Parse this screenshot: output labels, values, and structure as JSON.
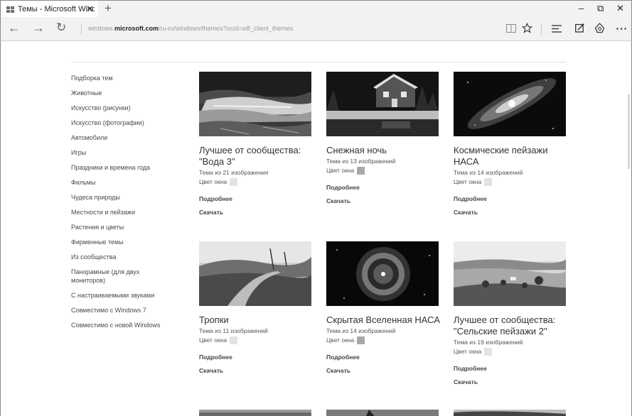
{
  "browser": {
    "tab_title": "Темы - Microsoft Windc",
    "tab_close": "✕",
    "new_tab": "+",
    "window_controls": {
      "minimize": "–",
      "maximize": "⧉",
      "close": "✕"
    },
    "nav": {
      "back": "←",
      "forward": "→",
      "refresh": "↻"
    },
    "url_prefix": "windows.",
    "url_domain": "microsoft.com",
    "url_path": "/ru-ru/windows/themes?ocid=w8_client_themes",
    "toolbar_icons": [
      "reading-view-icon",
      "favorite-star-icon",
      "hub-icon",
      "web-note-icon",
      "share-icon",
      "more-icon"
    ]
  },
  "sidebar": {
    "items": [
      "Подборка тем",
      "Животные",
      "Искусство (рисунки)",
      "Искусство (фотографии)",
      "Автомобили",
      "Игры",
      "Праздники и времена года",
      "Фильмы",
      "Чудеса природы",
      "Местности и пейзажи",
      "Растения и цветы",
      "Фирменные темы",
      "Из сообщества",
      "Панорамные (для двух мониторов)",
      "С настраиваемыми звуками",
      "Совместимо с Windows 7",
      "Совместимо с новой Windows"
    ]
  },
  "themes": [
    {
      "title": "Лучшее от сообщества: \"Вода 3\"",
      "subtitle": "Тема из 21 изображения",
      "color_label": "Цвет окна",
      "swatch": "#e3e3e3",
      "more": "Подробнее",
      "download": "Скачать"
    },
    {
      "title": "Снежная ночь",
      "subtitle": "Тема из 13 изображений",
      "color_label": "Цвет окна",
      "swatch": "#a9a9a9",
      "more": "Подробнее",
      "download": "Скачать"
    },
    {
      "title": "Космические пейзажи НАСА",
      "subtitle": "Тема из 14 изображений",
      "color_label": "Цвет окна",
      "swatch": "#e3e3e3",
      "more": "Подробнее",
      "download": "Скачать"
    },
    {
      "title": "Тропки",
      "subtitle": "Тема из 11 изображений",
      "color_label": "Цвет окна",
      "swatch": "#e3e3e3",
      "more": "Подробнее",
      "download": "Скачать"
    },
    {
      "title": "Скрытая Вселенная НАСА",
      "subtitle": "Тема из 14 изображений",
      "color_label": "Цвет окна",
      "swatch": "#a9a9a9",
      "more": "Подробнее",
      "download": "Скачать"
    },
    {
      "title": "Лучшее от сообщества: \"Сельские пейзажи 2\"",
      "subtitle": "Тема из 19 изображений",
      "color_label": "Цвет окна",
      "swatch": "#e3e3e3",
      "more": "Подробнее",
      "download": "Скачать"
    }
  ]
}
